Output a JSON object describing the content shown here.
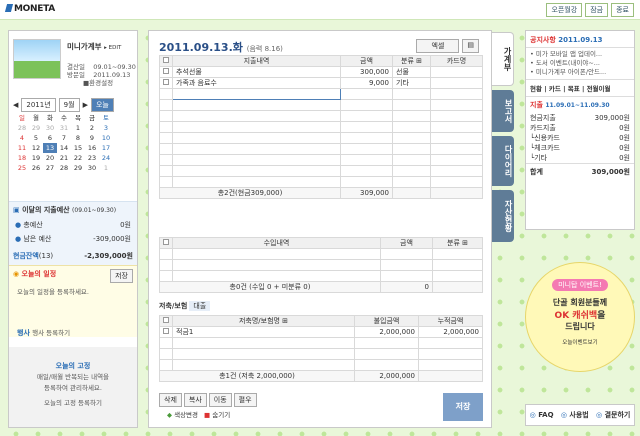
{
  "top": {
    "logo": "MONETA",
    "btn1": "오픈월강",
    "btn2": "잠금",
    "btn3": "종료"
  },
  "profile": {
    "title": "미니가계부",
    "edit": "▸ EDIT",
    "r1l": "결산일",
    "r1v": "09.01~09.30",
    "r2l": "방문일",
    "r2v": "2011.09.13",
    "link": "■환경설정"
  },
  "cal": {
    "year": "2011년",
    "month": "9월",
    "today": "오늘",
    "days": [
      "일",
      "월",
      "화",
      "수",
      "목",
      "금",
      "토"
    ],
    "weeks": [
      [
        "28",
        "29",
        "30",
        "31",
        "1",
        "2",
        "3"
      ],
      [
        "4",
        "5",
        "6",
        "7",
        "8",
        "9",
        "10"
      ],
      [
        "11",
        "12",
        "13",
        "14",
        "15",
        "16",
        "17"
      ],
      [
        "18",
        "19",
        "20",
        "21",
        "22",
        "23",
        "24"
      ],
      [
        "25",
        "26",
        "27",
        "28",
        "29",
        "30",
        "1"
      ]
    ]
  },
  "budget": {
    "title": "이달의 지출예산",
    "range": "(09.01~09.30)",
    "l1": "총예산",
    "v1": "0원",
    "l2": "남은 예산",
    "v2": "-309,000원"
  },
  "balance": {
    "label": "현금잔액",
    "count": "(13)",
    "val": "-2,309,000원"
  },
  "schedule": {
    "title": "오늘의 일정",
    "btn": "저장",
    "hint": "오늘의 일정을 등록하세요."
  },
  "event": {
    "label": "행사",
    "hint": "행사 등록하기"
  },
  "fixed": {
    "title": "오늘의 고정",
    "hint1": "매일/매월 반복되는 내역을",
    "hint2": "등록하여 관리하세요.",
    "link": "오늘의 고정 등록하기"
  },
  "main": {
    "date": "2011.09.13.화",
    "lunar": "(음력 8.16)",
    "excel": "엑셀",
    "exp": {
      "h": [
        "지출내역",
        "금액",
        "분류",
        "카드명"
      ],
      "rows": [
        [
          "추석선물",
          "300,000",
          "선물",
          ""
        ],
        [
          "가족과 음료수",
          "9,000",
          "기타",
          ""
        ]
      ],
      "sum": "총2건(현금309,000)",
      "sumv": "309,000"
    },
    "inc": {
      "h": [
        "수입내역",
        "금액",
        "분류"
      ],
      "sum": "총0건 (수입 0 + 미분류 0)",
      "sumv": "0"
    },
    "sav": {
      "tab1": "저축/보험",
      "tab2": "대출",
      "h": [
        "저축명/보험명",
        "불입금액",
        "누적금액"
      ],
      "rows": [
        [
          "적금1",
          "2,000,000",
          "2,000,000"
        ]
      ],
      "sum": "총1건 (저축 2,000,000)",
      "sumv": "2,000,000"
    },
    "actions": [
      "삭제",
      "복사",
      "이동",
      "펼우"
    ],
    "color": "색상변경",
    "hide": "숨기기",
    "save": "저장"
  },
  "tabs": [
    "가계부",
    "보고서",
    "다이어리",
    "자산현황"
  ],
  "notice": {
    "title": "공지사항",
    "date": "2011.09.13",
    "items": [
      "미가 모바일 앱 업데이...",
      "도서 이벤트(내이야~...",
      "미니가계부 아이폰/안드..."
    ]
  },
  "status": {
    "tabs": "현황 | 카드 | 목표 | 전월이월",
    "head": "지출",
    "range": "11.09.01~11.09.30",
    "r": [
      [
        "현금지출",
        "309,000원"
      ],
      [
        "카드지출",
        "0원"
      ],
      [
        "└신용카드",
        "0원"
      ],
      [
        "└체크카드",
        "0원"
      ],
      [
        "└기타",
        "0원"
      ]
    ],
    "total": "합계",
    "totalv": "309,000원"
  },
  "ad": {
    "tag": "미니탑 이벤트!",
    "l1": "단골 회원분들께",
    "l2": "OK 캐쉬백",
    "l3": "을",
    "l4": "드립니다",
    "more": "오늘이벤트보기"
  },
  "bottom": {
    "faq": "FAQ",
    "guide": "사용법",
    "board": "결문하기"
  }
}
